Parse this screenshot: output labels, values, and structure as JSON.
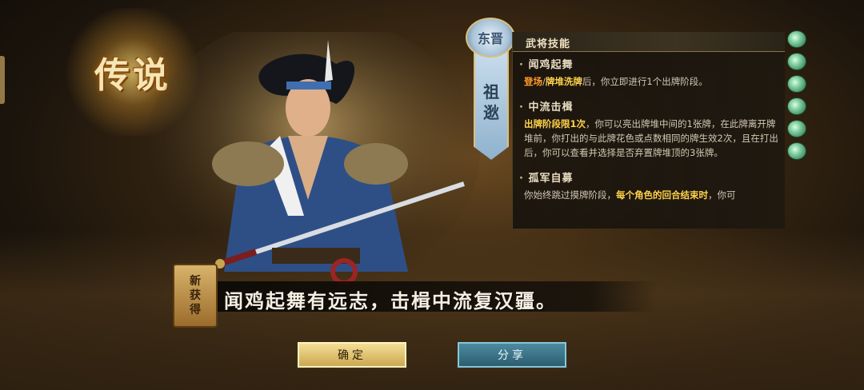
{
  "legend_badge": "传说",
  "faction": "东晋",
  "hero_name_chars": [
    "祖",
    "逖"
  ],
  "panel_title": "武将技能",
  "skills": [
    {
      "name": "闻鸡起舞",
      "desc_parts": [
        {
          "text": "登场",
          "style": "orange"
        },
        {
          "text": "/",
          "style": "plain"
        },
        {
          "text": "牌堆洗牌",
          "style": "yellow"
        },
        {
          "text": "后，你立即进行1个出牌阶段。",
          "style": "plain"
        }
      ]
    },
    {
      "name": "中流击楫",
      "desc_parts": [
        {
          "text": "出牌阶段限1次",
          "style": "yellow"
        },
        {
          "text": "，你可以亮出牌堆中间的1张牌，在此牌离开牌堆前，你打出的与此牌花色或点数相同的牌生效2次，且在打出后，你可以查看并选择是否弃置牌堆顶的3张牌。",
          "style": "plain"
        }
      ]
    },
    {
      "name": "孤军自募",
      "desc_parts": [
        {
          "text": "你始终跳过摸牌阶段，",
          "style": "plain"
        },
        {
          "text": "每个角色的回合结束时",
          "style": "yellow"
        },
        {
          "text": "，你可",
          "style": "plain"
        }
      ]
    }
  ],
  "hp_count": 6,
  "new_badge": [
    "新",
    "获",
    "得"
  ],
  "quote": "闻鸡起舞有远志，击楫中流复汉疆。",
  "buttons": {
    "confirm": "确定",
    "share": "分享"
  },
  "colors": {
    "highlight_orange": "#ff9a2a",
    "highlight_yellow": "#ffd24a",
    "jade": "#79c79a",
    "confirm_bg": "#e8cf7c",
    "share_bg": "#3c7a8e"
  }
}
